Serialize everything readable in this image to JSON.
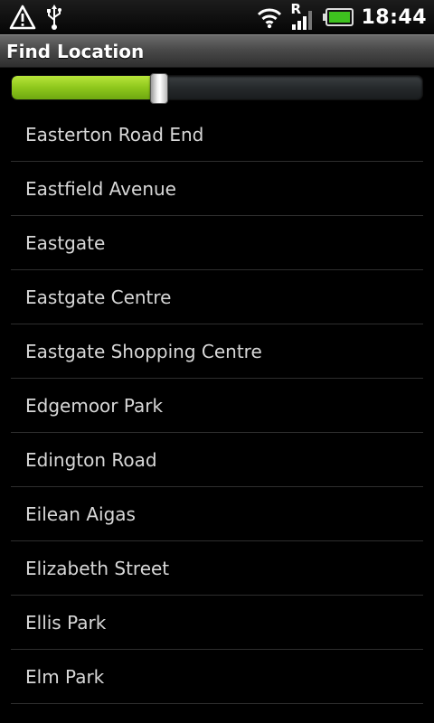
{
  "status_bar": {
    "time": "18:44",
    "network_type": "R",
    "icons": [
      "warning-icon",
      "usb-icon",
      "wifi-icon",
      "signal-icon",
      "battery-icon"
    ],
    "colors": {
      "battery": "#3ec21f",
      "text": "#ffffff"
    }
  },
  "header": {
    "title": "Find Location"
  },
  "progress": {
    "value": 0.36,
    "colors": {
      "fill": "#8ec71c",
      "track": "#262a2c"
    }
  },
  "locations": {
    "items": [
      {
        "label": "Easterton Road End"
      },
      {
        "label": "Eastfield Avenue"
      },
      {
        "label": "Eastgate"
      },
      {
        "label": "Eastgate Centre"
      },
      {
        "label": "Eastgate Shopping Centre"
      },
      {
        "label": "Edgemoor Park"
      },
      {
        "label": "Edington Road"
      },
      {
        "label": "Eilean Aigas"
      },
      {
        "label": "Elizabeth Street"
      },
      {
        "label": "Ellis Park"
      },
      {
        "label": "Elm Park"
      }
    ]
  }
}
